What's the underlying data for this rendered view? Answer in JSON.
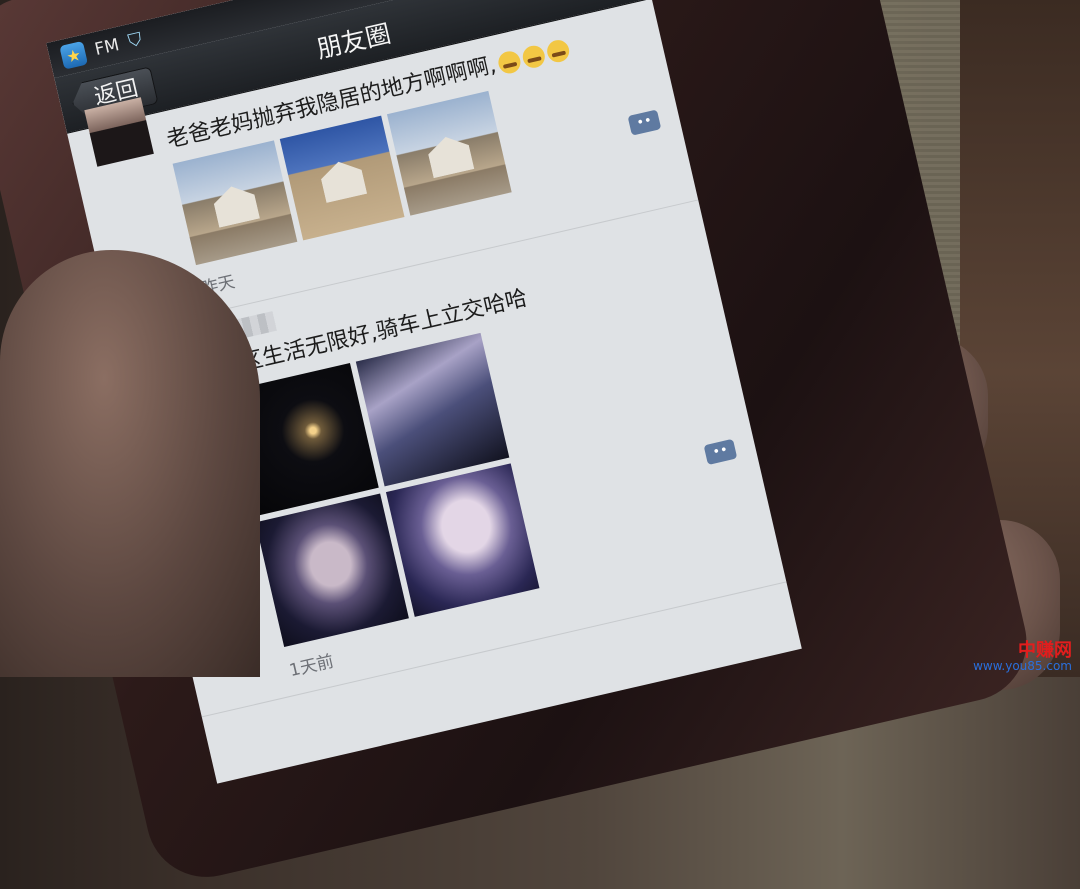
{
  "statusbar": {
    "app_label": "FM"
  },
  "navbar": {
    "back_label": "返回",
    "title": "朋友圈"
  },
  "posts": [
    {
      "text": "老爸老妈抛弃我隐居的地方啊啊啊,",
      "time": "昨天",
      "photo_count": 3
    },
    {
      "text": "东区生活无限好,骑车上立交哈哈",
      "time": "1天前",
      "photo_count": 4
    }
  ],
  "watermark": {
    "name": "中赚网",
    "url": "www.you85.com"
  }
}
